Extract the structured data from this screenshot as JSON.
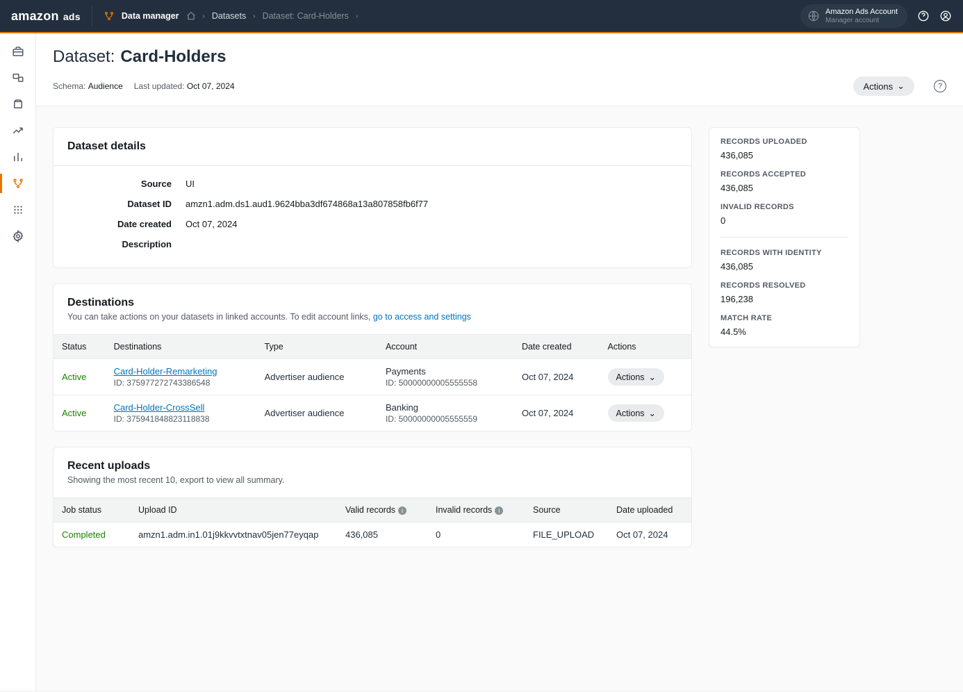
{
  "brand": {
    "main": "amazon",
    "sub": "ads"
  },
  "breadcrumb": {
    "data_manager": "Data manager",
    "datasets": "Datasets",
    "current": "Dataset: Card-Holders"
  },
  "account": {
    "line1": "Amazon Ads Account",
    "line2": "Manager account"
  },
  "page": {
    "title_prefix": "Dataset:",
    "title_name": "Card-Holders",
    "schema_label": "Schema:",
    "schema_value": "Audience",
    "updated_label": "Last updated:",
    "updated_value": "Oct 07, 2024",
    "actions_label": "Actions"
  },
  "details": {
    "heading": "Dataset details",
    "rows": {
      "source_k": "Source",
      "source_v": "UI",
      "id_k": "Dataset ID",
      "id_v": "amzn1.adm.ds1.aud1.9624bba3df674868a13a807858fb6f77",
      "created_k": "Date created",
      "created_v": "Oct 07, 2024",
      "desc_k": "Description",
      "desc_v": ""
    }
  },
  "destinations": {
    "heading": "Destinations",
    "sub_text": "You can take actions on your datasets in linked accounts. To edit account links, ",
    "sub_link": "go to access and settings",
    "cols": {
      "status": "Status",
      "dest": "Destinations",
      "type": "Type",
      "account": "Account",
      "created": "Date created",
      "actions": "Actions"
    },
    "rows": [
      {
        "status": "Active",
        "name": "Card-Holder-Remarketing",
        "id": "ID: 375977272743386548",
        "type": "Advertiser audience",
        "acct_name": "Payments",
        "acct_id": "ID: 50000000005555558",
        "created": "Oct 07, 2024",
        "action": "Actions"
      },
      {
        "status": "Active",
        "name": "Card-Holder-CrossSell",
        "id": "ID: 375941848823118838",
        "type": "Advertiser audience",
        "acct_name": "Banking",
        "acct_id": "ID: 50000000005555559",
        "created": "Oct 07, 2024",
        "action": "Actions"
      }
    ]
  },
  "uploads": {
    "heading": "Recent uploads",
    "sub": "Showing the most recent 10, export to view all summary.",
    "cols": {
      "status": "Job status",
      "id": "Upload ID",
      "valid": "Valid records",
      "invalid": "Invalid records",
      "source": "Source",
      "date": "Date uploaded"
    },
    "rows": [
      {
        "status": "Completed",
        "id": "amzn1.adm.in1.01j9kkvvtxtnav05jen77eyqap",
        "valid": "436,085",
        "invalid": "0",
        "source": "FILE_UPLOAD",
        "date": "Oct 07, 2024"
      }
    ]
  },
  "stats": {
    "uploaded_l": "Records Uploaded",
    "uploaded_v": "436,085",
    "accepted_l": "Records Accepted",
    "accepted_v": "436,085",
    "invalid_l": "Invalid Records",
    "invalid_v": "0",
    "identity_l": "Records with Identity",
    "identity_v": "436,085",
    "resolved_l": "Records Resolved",
    "resolved_v": "196,238",
    "match_l": "Match Rate",
    "match_v": "44.5%"
  }
}
